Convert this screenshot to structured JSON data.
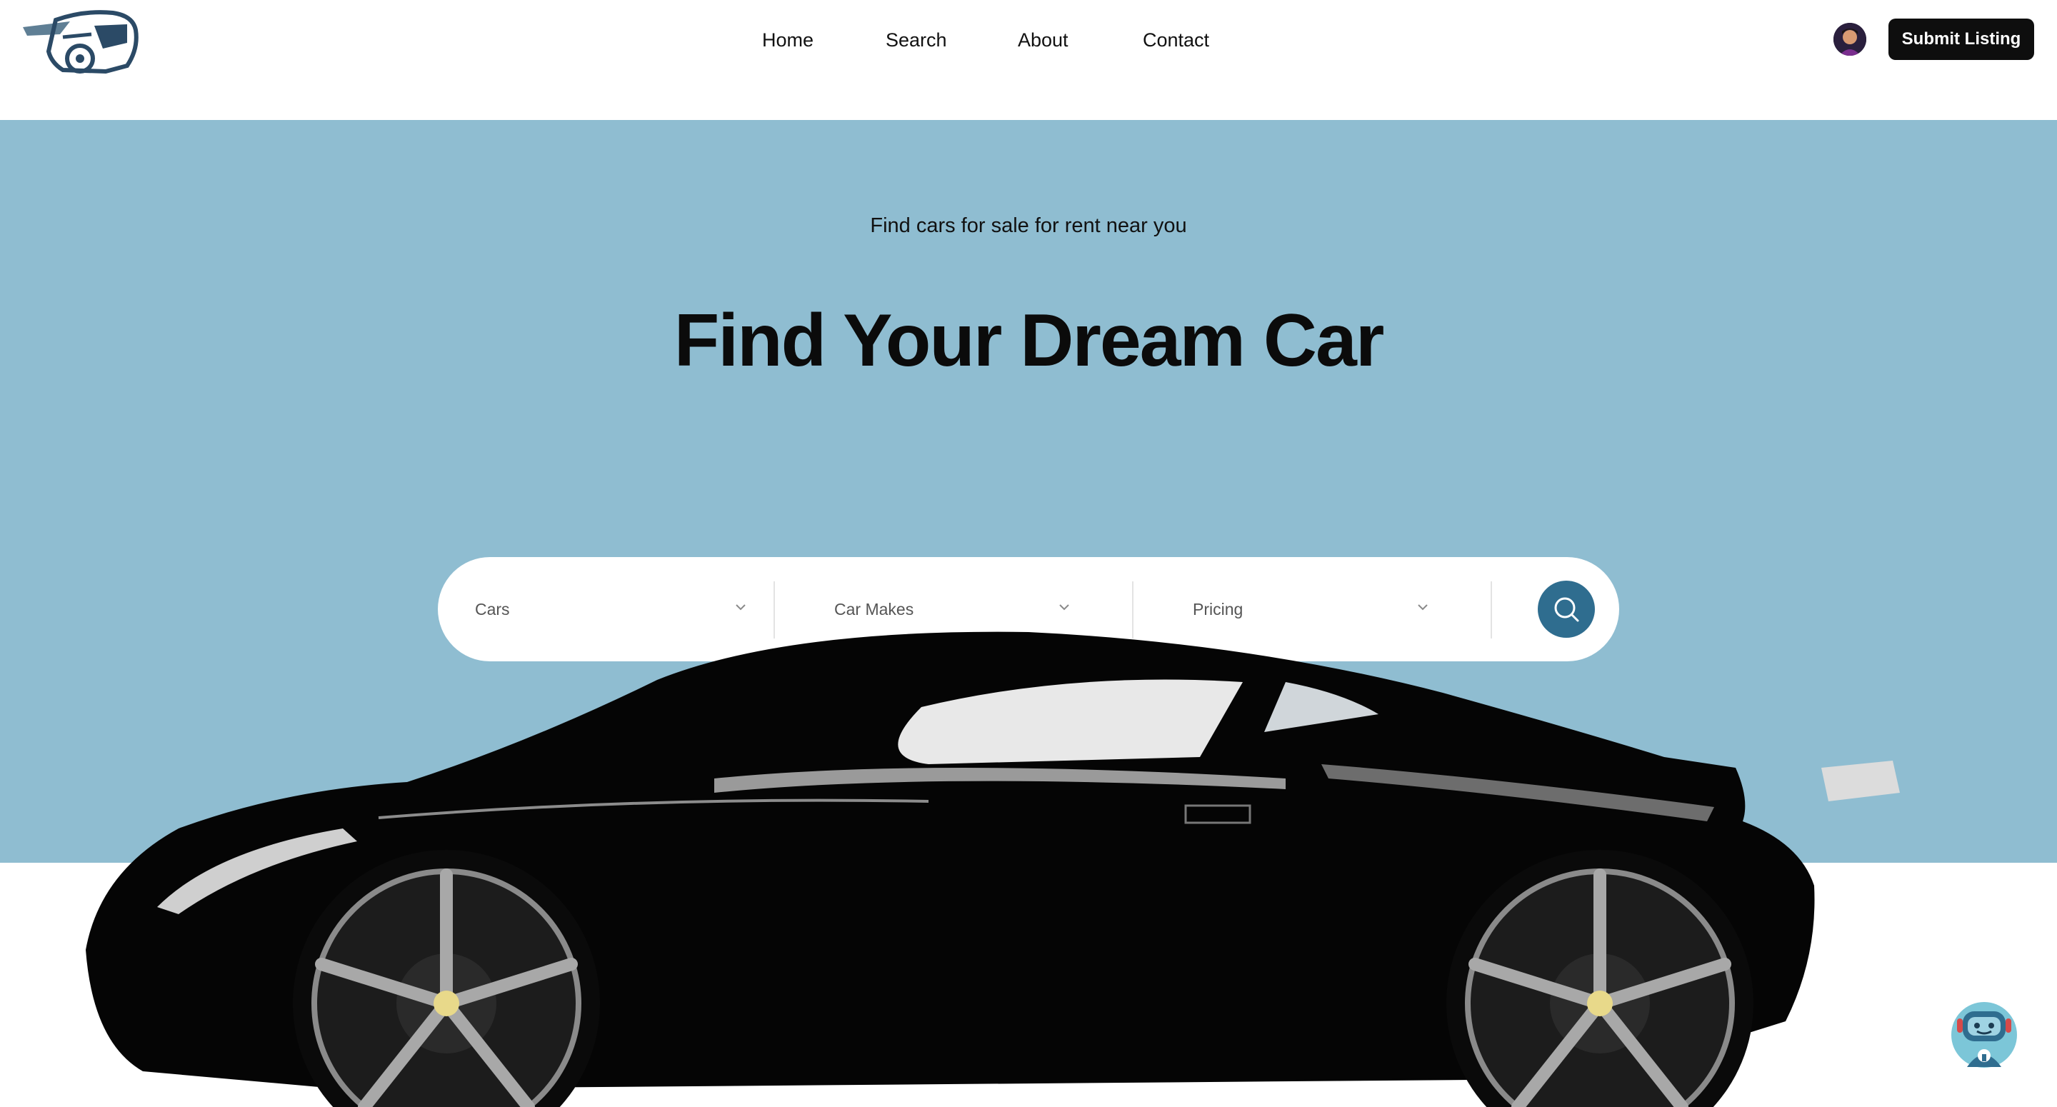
{
  "brand": {
    "logo_icon": "car-logo-icon",
    "colors": {
      "hero_bg": "#8fbdd1",
      "accent": "#2f6d8f",
      "button_dark": "#0e0e0e"
    }
  },
  "nav": {
    "items": [
      {
        "label": "Home"
      },
      {
        "label": "Search"
      },
      {
        "label": "About"
      },
      {
        "label": "Contact"
      }
    ]
  },
  "header": {
    "submit_label": "Submit Listing",
    "avatar_icon": "user-avatar"
  },
  "hero": {
    "tagline": "Find cars for sale for rent near you",
    "title": "Find Your Dream Car"
  },
  "search": {
    "filters": [
      {
        "value": "Cars",
        "icon": "chevron-down-icon"
      },
      {
        "value": "Car Makes",
        "icon": "chevron-down-icon"
      },
      {
        "value": "Pricing",
        "icon": "chevron-down-icon"
      }
    ],
    "button_icon": "search-icon"
  },
  "chatbot": {
    "icon": "robot-assistant-icon"
  }
}
